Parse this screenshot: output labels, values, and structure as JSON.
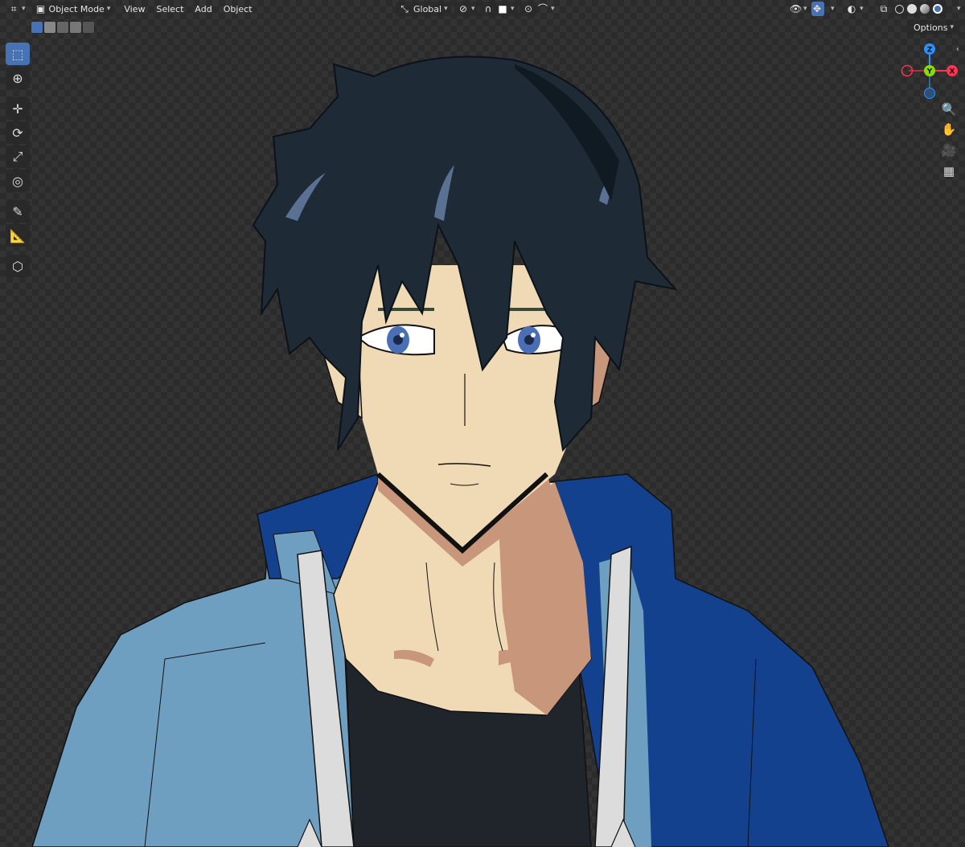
{
  "header": {
    "editor_type_icon": "axis-grid-icon",
    "mode": "Object Mode",
    "menus": [
      "View",
      "Select",
      "Add",
      "Object"
    ],
    "transform_orientation": "Global",
    "options_label": "Options"
  },
  "toolbar": {
    "tools": [
      "select-box-icon",
      "cursor-icon",
      "move-icon",
      "rotate-icon",
      "scale-icon",
      "transform-icon",
      "annotate-icon",
      "measure-icon",
      "add-cube-icon"
    ],
    "active_tool": "select-box-icon"
  },
  "gizmo": {
    "z_label": "Z",
    "y_label": "Y",
    "x_label": "X"
  },
  "colors": {
    "accent": "#4772b3",
    "axis_x": "#ff3352",
    "axis_y": "#8bdc00",
    "axis_z": "#2890ff",
    "hair": "#1e2a35",
    "skin": "#f0dab5",
    "skin_shadow": "#c8967a",
    "jacket_light": "#6f9fc0",
    "jacket_dark": "#13418d",
    "collar_white": "#dcdcdc",
    "shirt": "#20252c",
    "eye": "#4a6fb5"
  }
}
